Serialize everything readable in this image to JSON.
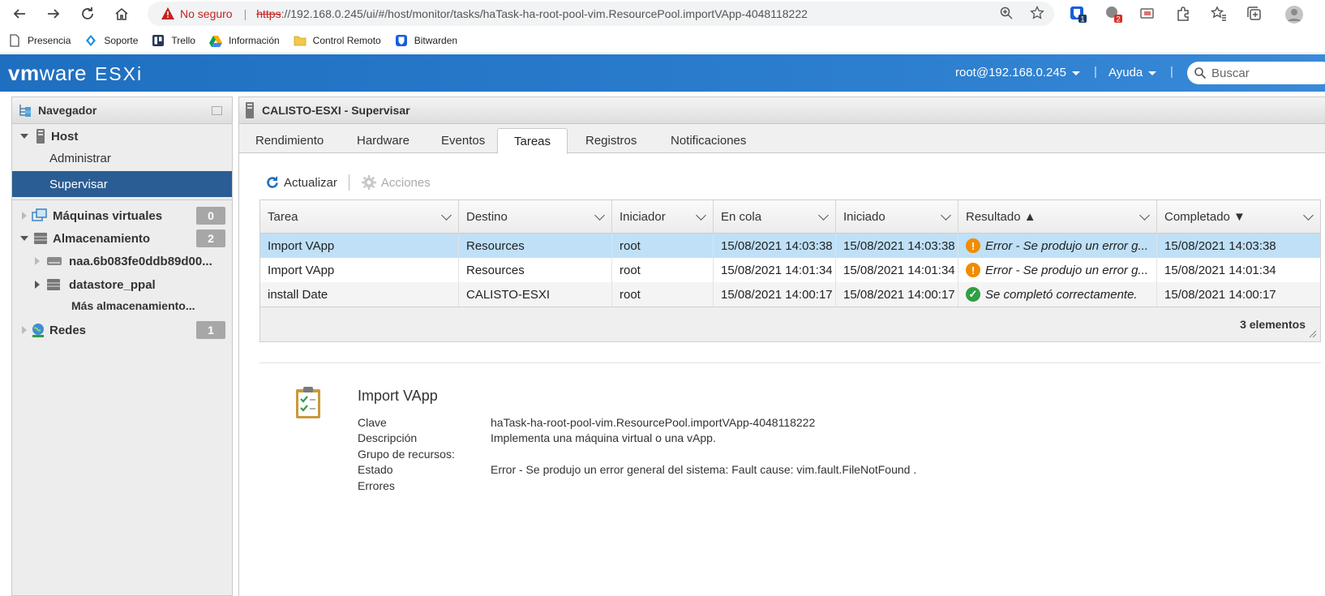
{
  "browser": {
    "insecure_label": "No seguro",
    "url_scheme": "https",
    "url_rest": "://192.168.0.245/ui/#/host/monitor/tasks/haTask-ha-root-pool-vim.ResourcePool.importVApp-4048118222",
    "ext_badge_1": "1",
    "ext_badge_2": "2",
    "bookmarks": [
      "Presencia",
      "Soporte",
      "Trello",
      "Información",
      "Control Remoto",
      "Bitwarden"
    ]
  },
  "header": {
    "logo_vm": "vm",
    "logo_ware": "ware",
    "product": "ESXi",
    "user": "root@192.168.0.245",
    "help": "Ayuda",
    "search_placeholder": "Buscar"
  },
  "navigator": {
    "title": "Navegador",
    "host": "Host",
    "manage": "Administrar",
    "monitor": "Supervisar",
    "vms": "Máquinas virtuales",
    "vms_count": "0",
    "storage": "Almacenamiento",
    "storage_count": "2",
    "disk": "naa.6b083fe0ddb89d00...",
    "datastore": "datastore_ppal",
    "more_storage": "Más almacenamiento...",
    "networks": "Redes",
    "networks_count": "1"
  },
  "main": {
    "title": "CALISTO-ESXI - Supervisar",
    "tabs": [
      "Rendimiento",
      "Hardware",
      "Eventos",
      "Tareas",
      "Registros",
      "Notificaciones"
    ],
    "refresh": "Actualizar",
    "actions": "Acciones"
  },
  "tasks": {
    "columns": [
      "Tarea",
      "Destino",
      "Iniciador",
      "En cola",
      "Iniciado",
      "Resultado ▲",
      "Completado ▼"
    ],
    "rows": [
      {
        "task": "Import VApp",
        "target": "Resources",
        "initiator": "root",
        "queued": "15/08/2021 14:03:38",
        "started": "15/08/2021 14:03:38",
        "result": "Error - Se produjo un error g...",
        "completed": "15/08/2021 14:03:38"
      },
      {
        "task": "Import VApp",
        "target": "Resources",
        "initiator": "root",
        "queued": "15/08/2021 14:01:34",
        "started": "15/08/2021 14:01:34",
        "result": "Error - Se produjo un error g...",
        "completed": "15/08/2021 14:01:34"
      },
      {
        "task": "install Date",
        "target": "CALISTO-ESXI",
        "initiator": "root",
        "queued": "15/08/2021 14:00:17",
        "started": "15/08/2021 14:00:17",
        "result": "Se completó correctamente.",
        "completed": "15/08/2021 14:00:17"
      }
    ],
    "count": "3 elementos"
  },
  "detail": {
    "title": "Import VApp",
    "keys": {
      "clave": "Clave",
      "descripcion": "Descripción",
      "grupo": "Grupo de recursos:",
      "estado": "Estado",
      "errores": "Errores"
    },
    "values": {
      "clave": "haTask-ha-root-pool-vim.ResourcePool.importVApp-4048118222",
      "descripcion": "Implementa una máquina virtual o una vApp.",
      "estado": "Error - Se produjo un error general del sistema: Fault cause: vim.fault.FileNotFound ."
    }
  },
  "colors": {
    "header_blue": "#2d7fcf",
    "selected_nav": "#2a5d93",
    "selected_row": "#bfe0f7",
    "error_orange": "#f08c00",
    "ok_green": "#2f9e44"
  }
}
